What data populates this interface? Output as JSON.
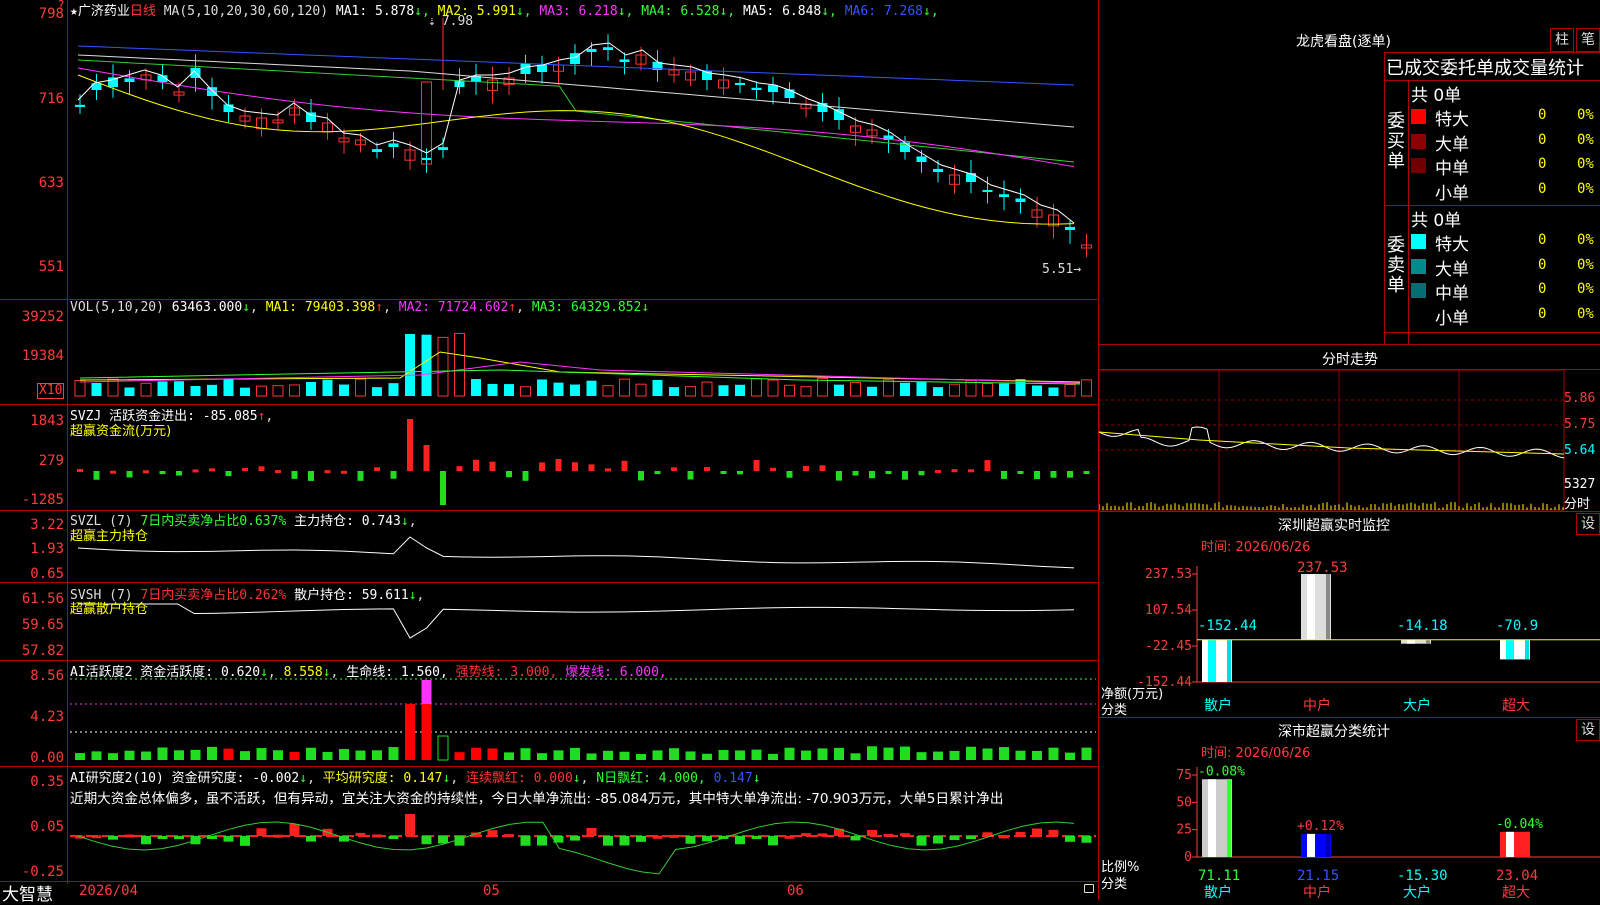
{
  "app_name": "大智慧",
  "header": {
    "star": "★",
    "stock_name": "广济药业",
    "period": "日线",
    "ma_label": "MA(5,10,20,30,60,120)",
    "ma_items": [
      {
        "label": "MA1: 5.878",
        "arrow": "↓",
        "color": "#ffffff"
      },
      {
        "label": "MA2: 5.991",
        "arrow": "↓",
        "color": "#ffff00"
      },
      {
        "label": "MA3: 6.218",
        "arrow": "↓",
        "color": "#ff33ff"
      },
      {
        "label": "MA4: 6.528",
        "arrow": "↓",
        "color": "#33ff33"
      },
      {
        "label": "MA5: 6.848",
        "arrow": "↓",
        "color": "#ffffff"
      },
      {
        "label": "MA6: 7.268",
        "arrow": "↓",
        "color": "#3355ff"
      }
    ],
    "high_mark": "7.98",
    "low_mark": "5.51"
  },
  "price_axis": [
    "798",
    "716",
    "633",
    "551"
  ],
  "vol": {
    "label": "VOL(5,10,20)",
    "value": "63463.000",
    "ma1": "MA1: 79403.398",
    "ma2": "MA2: 71724.602",
    "ma3": "MA3: 64329.852",
    "axis": [
      "39252",
      "19384"
    ],
    "unit": "X10"
  },
  "svzj": {
    "line1": "SVZJ  活跃资金进出: -85.085",
    "line2": "超赢资金流(万元)",
    "axis": [
      "1843",
      "279",
      "-1285"
    ]
  },
  "svzl": {
    "prefix": "SVZL (7)",
    "mid": "7日内买卖净占比0.637%",
    "suffix": "主力持仓: 0.743",
    "line2": "超赢主力持仓",
    "axis": [
      "3.22",
      "1.93",
      "0.65"
    ]
  },
  "svsh": {
    "prefix": "SVSH (7)",
    "mid": "7日内买卖净占比0.262%",
    "suffix": "散户持仓: 59.611",
    "line2": "超赢散户持仓",
    "axis": [
      "61.56",
      "59.65",
      "57.82"
    ]
  },
  "ai_active": {
    "p1": "AI活跃度2 资金活跃度: 0.620",
    "p2": "8.558",
    "p3": "生命线: 1.560,",
    "p4": "强势线: 3.000,",
    "p5": "爆发线: 6.000,",
    "axis": [
      "8.56",
      "4.23",
      "0.00"
    ]
  },
  "ai_research": {
    "p1": "AI研究度2(10) 资金研究度: -0.002",
    "p2": "平均研究度: 0.147",
    "p3": "连续飘红: 0.000",
    "p4": "N日飘红: 4.000,",
    "p5": "0.147",
    "commentary": "近期大资金总体偏多，虽不活跃，但有异动，宜关注大资金的持续性，今日大单净流出: -85.084万元，其中特大单净流出: -70.903万元，大单5日累计净出",
    "axis": [
      "0.35",
      "0.05",
      "-0.25"
    ]
  },
  "date_axis": [
    "2026/04",
    "05",
    "06"
  ],
  "right": {
    "lhb_title": "龙虎看盘(逐单)",
    "btn_bar": "柱",
    "btn_pen": "笔",
    "stats_title": "已成交委托单成交量统计",
    "buy_side": "委买单",
    "sell_side": "委卖单",
    "buy_total": "共 0单",
    "sell_total": "共 0单",
    "buy_rows": [
      {
        "label": "特大",
        "count": "0",
        "pct": "0%",
        "color": "#ff0000"
      },
      {
        "label": "大单",
        "count": "0",
        "pct": "0%",
        "color": "#8b0000"
      },
      {
        "label": "中单",
        "count": "0",
        "pct": "0%",
        "color": "#6e0000"
      },
      {
        "label": "小单",
        "count": "0",
        "pct": "0%",
        "color": ""
      }
    ],
    "sell_rows": [
      {
        "label": "特大",
        "count": "0",
        "pct": "0%",
        "color": "#00ffff"
      },
      {
        "label": "大单",
        "count": "0",
        "pct": "0%",
        "color": "#008b8b"
      },
      {
        "label": "中单",
        "count": "0",
        "pct": "0%",
        "color": "#006f6f"
      },
      {
        "label": "小单",
        "count": "0",
        "pct": "0%",
        "color": ""
      }
    ],
    "intraday_title": "分时走势",
    "intraday_axis": [
      "5.86",
      "5.75",
      "5.64"
    ],
    "intraday_vol": "5327",
    "intraday_unit": "分时",
    "monitor_title": "深圳超赢实时监控",
    "monitor_time": "时间: 2026/06/26",
    "monitor_btn": "设",
    "monitor_y_title": "净额(万元)",
    "monitor_x_title": "分类",
    "classify_title": "深市超赢分类统计",
    "classify_time": "时间: 2026/06/26",
    "classify_btn": "设",
    "classify_y_title": "比例%",
    "classify_x_title": "分类"
  },
  "chart_data": [
    {
      "type": "bar",
      "title": "深圳超赢实时监控",
      "ylabel": "净额(万元)",
      "xlabel": "分类",
      "categories": [
        "散户",
        "中户",
        "大户",
        "超大"
      ],
      "values": [
        -152.44,
        237.53,
        -14.18,
        -70.9
      ],
      "value_labels": [
        "-152.44",
        "237.53",
        "-14.18",
        "-70.9"
      ],
      "yticks": [
        "237.53",
        "107.54",
        "-22.45",
        "-152.44"
      ],
      "ylim": [
        -152.44,
        237.53
      ]
    },
    {
      "type": "bar",
      "title": "深市超赢分类统计",
      "ylabel": "比例%",
      "xlabel": "分类",
      "categories": [
        "散户",
        "中户",
        "大户",
        "超大"
      ],
      "values": [
        71.11,
        21.15,
        -15.3,
        23.04
      ],
      "value_labels": [
        "71.11",
        "21.15",
        "-15.30",
        "23.04"
      ],
      "changes": [
        "-0.08%",
        "+0.12%",
        "",
        "-0.04%"
      ],
      "yticks": [
        "75",
        "50",
        "25",
        "0"
      ],
      "ylim": [
        0,
        75
      ]
    }
  ]
}
